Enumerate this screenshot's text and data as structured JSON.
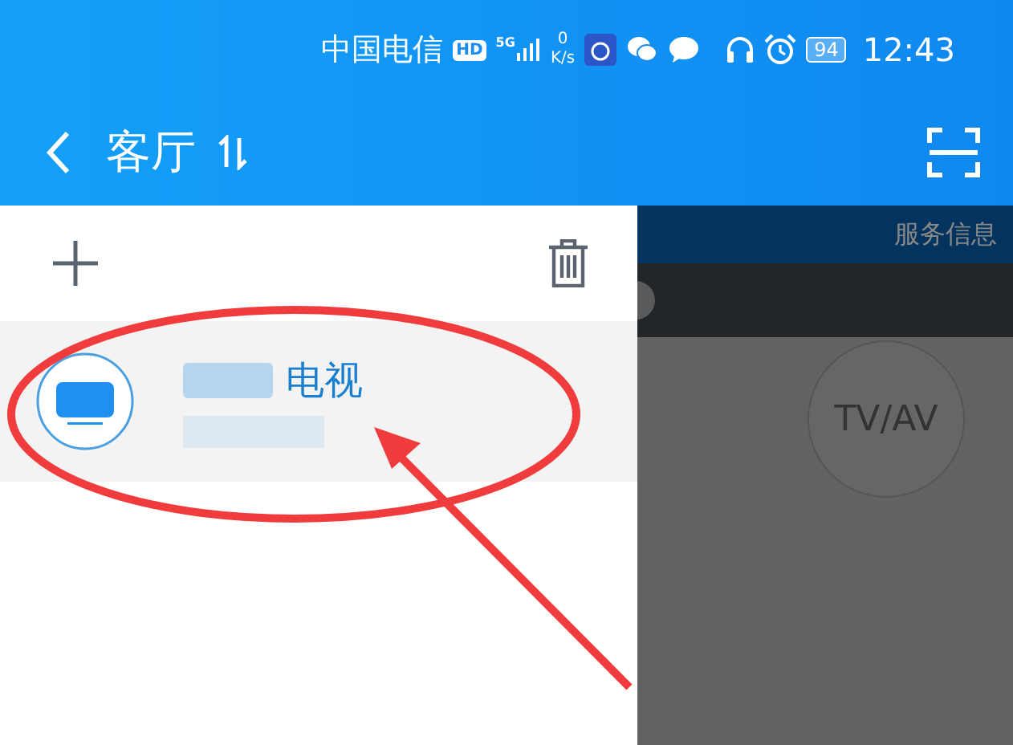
{
  "status_bar": {
    "carrier": "中国电信",
    "hd_badge": "HD",
    "network": "5G",
    "speed_value": "0",
    "speed_unit": "K/s",
    "battery": "94",
    "time": "12:43"
  },
  "header": {
    "title": "客厅"
  },
  "drawer": {
    "devices": [
      {
        "name": "电视",
        "selected": true
      }
    ]
  },
  "background_panel": {
    "service_label": "服务信息",
    "mode_button": "TV/AV"
  }
}
